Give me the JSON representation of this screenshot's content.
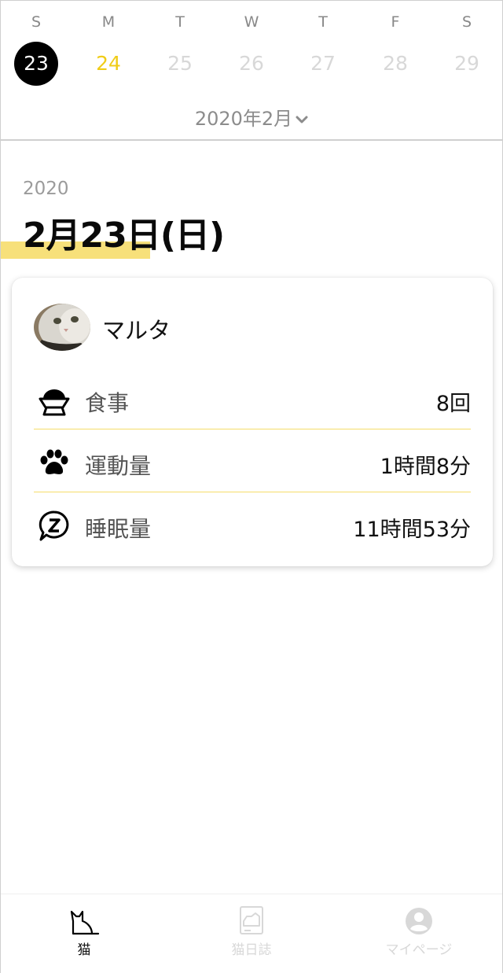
{
  "calendar": {
    "days": [
      {
        "dow": "S",
        "date": "23",
        "state": "selected"
      },
      {
        "dow": "M",
        "date": "24",
        "state": "today"
      },
      {
        "dow": "T",
        "date": "25",
        "state": "future"
      },
      {
        "dow": "W",
        "date": "26",
        "state": "future"
      },
      {
        "dow": "T",
        "date": "27",
        "state": "future"
      },
      {
        "dow": "F",
        "date": "28",
        "state": "future"
      },
      {
        "dow": "S",
        "date": "29",
        "state": "future"
      }
    ],
    "month_label": "2020年2月"
  },
  "header": {
    "year": "2020",
    "date": "2月23日(日)"
  },
  "card": {
    "pet_name": "マルタ",
    "rows": [
      {
        "icon": "food-bowl-icon",
        "label": "食事",
        "value": "8回"
      },
      {
        "icon": "paw-icon",
        "label": "運動量",
        "value": "1時間8分"
      },
      {
        "icon": "sleep-icon",
        "label": "睡眠量",
        "value": "11時間53分"
      }
    ]
  },
  "tabbar": {
    "tabs": [
      {
        "icon": "cat-icon",
        "label": "猫",
        "active": true
      },
      {
        "icon": "diary-icon",
        "label": "猫日誌",
        "active": false
      },
      {
        "icon": "profile-icon",
        "label": "マイページ",
        "active": false
      }
    ]
  },
  "colors": {
    "accent": "#f0cc17",
    "highlight": "#f7e07a",
    "divider": "#f5dd6a"
  }
}
